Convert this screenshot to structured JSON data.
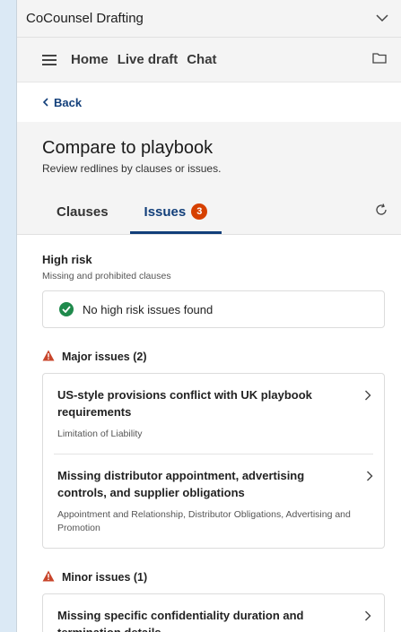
{
  "app": {
    "title": "CoCounsel Drafting"
  },
  "nav": {
    "home": "Home",
    "live_draft": "Live draft",
    "chat": "Chat"
  },
  "back": {
    "label": "Back"
  },
  "header": {
    "title": "Compare to playbook",
    "subtitle": "Review redlines by clauses or issues."
  },
  "tabs": {
    "clauses": "Clauses",
    "issues": "Issues",
    "issues_count": "3"
  },
  "high_risk": {
    "title": "High risk",
    "subtitle": "Missing and prohibited clauses",
    "status": "No high risk issues found"
  },
  "major": {
    "title": "Major issues (2)",
    "items": [
      {
        "title": "US-style provisions conflict with UK playbook requirements",
        "category": "Limitation of Liability"
      },
      {
        "title": "Missing distributor appointment, advertising controls, and supplier obligations",
        "category": "Appointment and Relationship, Distributor Obligations, Advertising and Promotion"
      }
    ]
  },
  "minor": {
    "title": "Minor issues (1)",
    "items": [
      {
        "title": "Missing specific confidentiality duration and termination details"
      }
    ]
  },
  "colors": {
    "accent": "#123f7a",
    "badge": "#d64000",
    "success": "#1f8a4c",
    "warning": "#c8452b"
  }
}
